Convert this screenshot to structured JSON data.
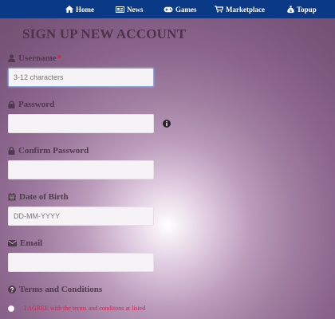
{
  "nav": {
    "items": [
      {
        "label": "Home",
        "icon": "home-icon"
      },
      {
        "label": "News",
        "icon": "newspaper-icon"
      },
      {
        "label": "Games",
        "icon": "gamepad-icon"
      },
      {
        "label": "Marketplace",
        "icon": "shopping-cart-icon"
      },
      {
        "label": "Topup",
        "icon": "money-bag-icon"
      }
    ]
  },
  "form": {
    "title": "SIGN UP NEW ACCOUNT",
    "username": {
      "label": "Username",
      "required_mark": "*",
      "value": "",
      "placeholder": "3-12 characters",
      "icon": "user-icon"
    },
    "password": {
      "label": "Password",
      "value": "",
      "placeholder": "",
      "icon": "lock-icon",
      "hint_icon": "info-icon"
    },
    "confirm_password": {
      "label": "Confirm Password",
      "value": "",
      "placeholder": "",
      "icon": "lock-icon"
    },
    "dob": {
      "label": "Date of Birth",
      "value": "",
      "placeholder": "DD-MM-YYYY",
      "icon": "calendar-icon"
    },
    "email": {
      "label": "Email",
      "value": "",
      "placeholder": "",
      "icon": "envelope-icon"
    },
    "terms": {
      "heading": "Terms and Conditions",
      "agree_text": "I AGREE with the terms and conditons at listed",
      "icon": "question-circle-icon"
    }
  },
  "colors": {
    "nav_bg": "#0a3a86",
    "required": "#d0233f",
    "agree_text": "#d8204a",
    "title": "#4a3548"
  }
}
